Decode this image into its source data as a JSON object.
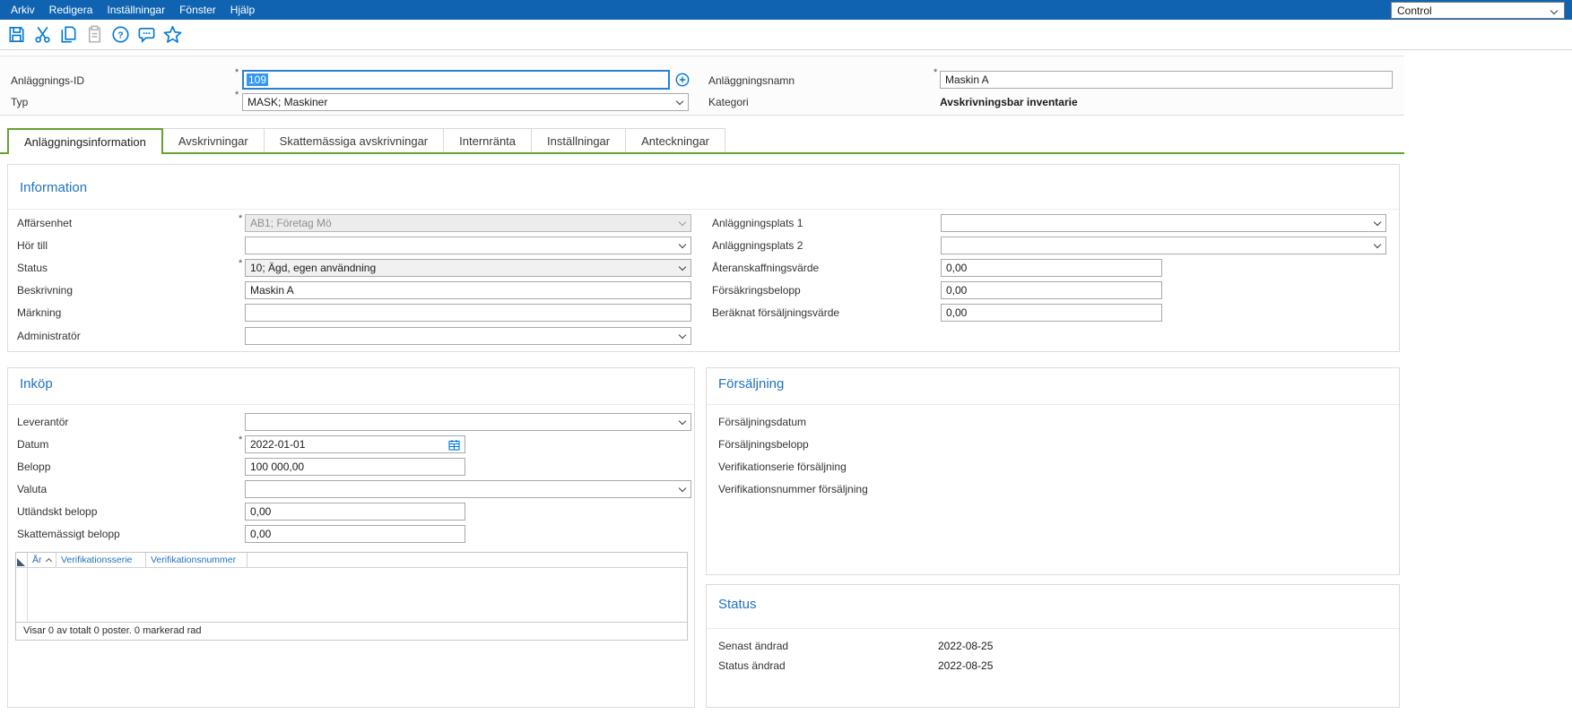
{
  "colors": {
    "menubar_bg": "#0f63b1",
    "icon_blue": "#0078d4",
    "section_title_blue": "#1e73be",
    "active_tab_green": "#65a230",
    "selection_blue": "#3297f3",
    "focus_border_blue": "#2a7fd4"
  },
  "menubar": {
    "items": [
      "Arkiv",
      "Redigera",
      "Inställningar",
      "Fönster",
      "Hjälp"
    ],
    "control_label": "Control"
  },
  "toolbar": {
    "icons": [
      "save-icon",
      "cut-icon",
      "copy-icon",
      "paste-icon",
      "help-icon",
      "comment-icon",
      "favorite-icon"
    ]
  },
  "header": {
    "anlaggnings_id": {
      "label": "Anläggnings-ID",
      "required_marker": "*",
      "value": "109"
    },
    "anlaggningsnamn": {
      "label": "Anläggningsnamn",
      "required_marker": "*",
      "value": "Maskin A"
    },
    "typ": {
      "label": "Typ",
      "required_marker": "*",
      "value": "MASK; Maskiner"
    },
    "kategori": {
      "label": "Kategori",
      "value": "Avskrivningsbar inventarie"
    }
  },
  "tabs": [
    {
      "label": "Anläggningsinformation",
      "active": true
    },
    {
      "label": "Avskrivningar",
      "active": false
    },
    {
      "label": "Skattemässiga avskrivningar",
      "active": false
    },
    {
      "label": "Internränta",
      "active": false
    },
    {
      "label": "Inställningar",
      "active": false
    },
    {
      "label": "Anteckningar",
      "active": false
    }
  ],
  "information": {
    "title": "Information",
    "left": [
      {
        "label": "Affärsenhet",
        "required_marker": "*",
        "value": "AB1; Företag Mö"
      },
      {
        "label": "Hör till",
        "value": ""
      },
      {
        "label": "Status",
        "required_marker": "*",
        "value": "10; Ägd, egen användning"
      },
      {
        "label": "Beskrivning",
        "value": "Maskin A"
      },
      {
        "label": "Märkning",
        "value": ""
      },
      {
        "label": "Administratör",
        "value": ""
      }
    ],
    "right": [
      {
        "label": "Anläggningsplats 1",
        "value": ""
      },
      {
        "label": "Anläggningsplats 2",
        "value": ""
      },
      {
        "label": "Återanskaffningsvärde",
        "value": "0,00"
      },
      {
        "label": "Försäkringsbelopp",
        "value": "0,00"
      },
      {
        "label": "Beräknat försäljningsvärde",
        "value": "0,00"
      }
    ]
  },
  "inkop": {
    "title": "Inköp",
    "rows": [
      {
        "label": "Leverantör",
        "value": ""
      },
      {
        "label": "Datum",
        "required_marker": "*",
        "value": "2022-01-01"
      },
      {
        "label": "Belopp",
        "value": "100 000,00"
      },
      {
        "label": "Valuta",
        "value": ""
      },
      {
        "label": "Utländskt belopp",
        "value": "0,00"
      },
      {
        "label": "Skattemässigt belopp",
        "value": "0,00"
      }
    ],
    "grid": {
      "columns": [
        "År",
        "Verifikationsserie",
        "Verifikationsnummer"
      ],
      "sorted_column": "År",
      "sort_direction": "ascending",
      "rows": [],
      "footer": "Visar 0 av totalt 0 poster. 0 markerad rad"
    }
  },
  "forsaljning": {
    "title": "Försäljning",
    "labels": [
      "Försäljningsdatum",
      "Försäljningsbelopp",
      "Verifikationserie försäljning",
      "Verifikationsnummer försäljning"
    ]
  },
  "status_section": {
    "title": "Status",
    "rows": [
      {
        "label": "Senast ändrad",
        "value": "2022-08-25"
      },
      {
        "label": "Status ändrad",
        "value": "2022-08-25"
      }
    ]
  }
}
